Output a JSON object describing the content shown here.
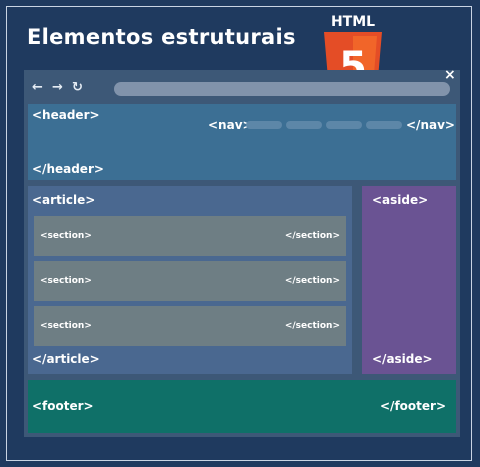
{
  "title": "Elementos estruturais",
  "logo": {
    "text": "HTML",
    "number": "5",
    "colors": {
      "shield": "#e44d26",
      "shield_light": "#f16529"
    }
  },
  "browser": {
    "back_icon": "←",
    "forward_icon": "→",
    "reload_icon": "↻",
    "close_icon": "×"
  },
  "header": {
    "open": "<header>",
    "close": "</header>"
  },
  "nav": {
    "open": "<nav>",
    "close": "</nav>"
  },
  "article": {
    "open": "<article>",
    "close": "</article>"
  },
  "sections": [
    {
      "open": "<section>",
      "close": "</section>"
    },
    {
      "open": "<section>",
      "close": "</section>"
    },
    {
      "open": "<section>",
      "close": "</section>"
    }
  ],
  "aside": {
    "open": "<aside>",
    "close": "</aside>"
  },
  "footer": {
    "open": "<footer>",
    "close": "</footer>"
  },
  "colors": {
    "background": "#1f3a5f",
    "header": "#3c6f94",
    "article": "#4a6890",
    "section": "#6e7e84",
    "aside": "#6a5393",
    "footer": "#0f7068"
  }
}
